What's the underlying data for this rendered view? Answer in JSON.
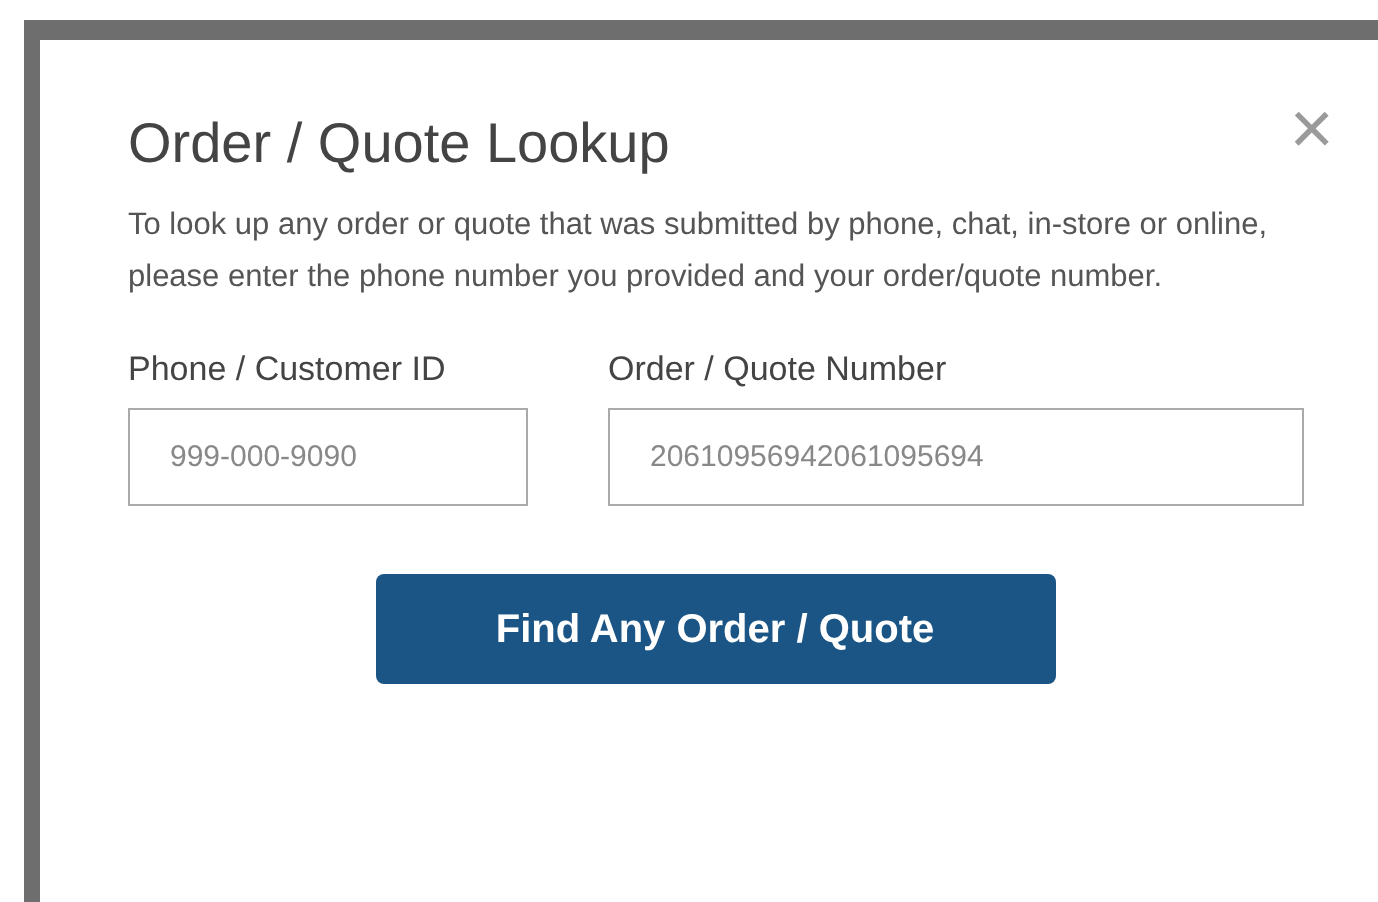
{
  "dialog": {
    "title": "Order / Quote Lookup",
    "close": "×",
    "description": "To look up any order or quote that was submitted by phone, chat, in-store or online, please enter the phone number you provided and your order/quote number.",
    "fields": [
      {
        "label": "Phone / Customer ID",
        "placeholder": "999-000-9090"
      },
      {
        "label": "Order / Quote Number",
        "placeholder": "20610956942061095694"
      }
    ],
    "button": "Find Any Order / Quote"
  }
}
